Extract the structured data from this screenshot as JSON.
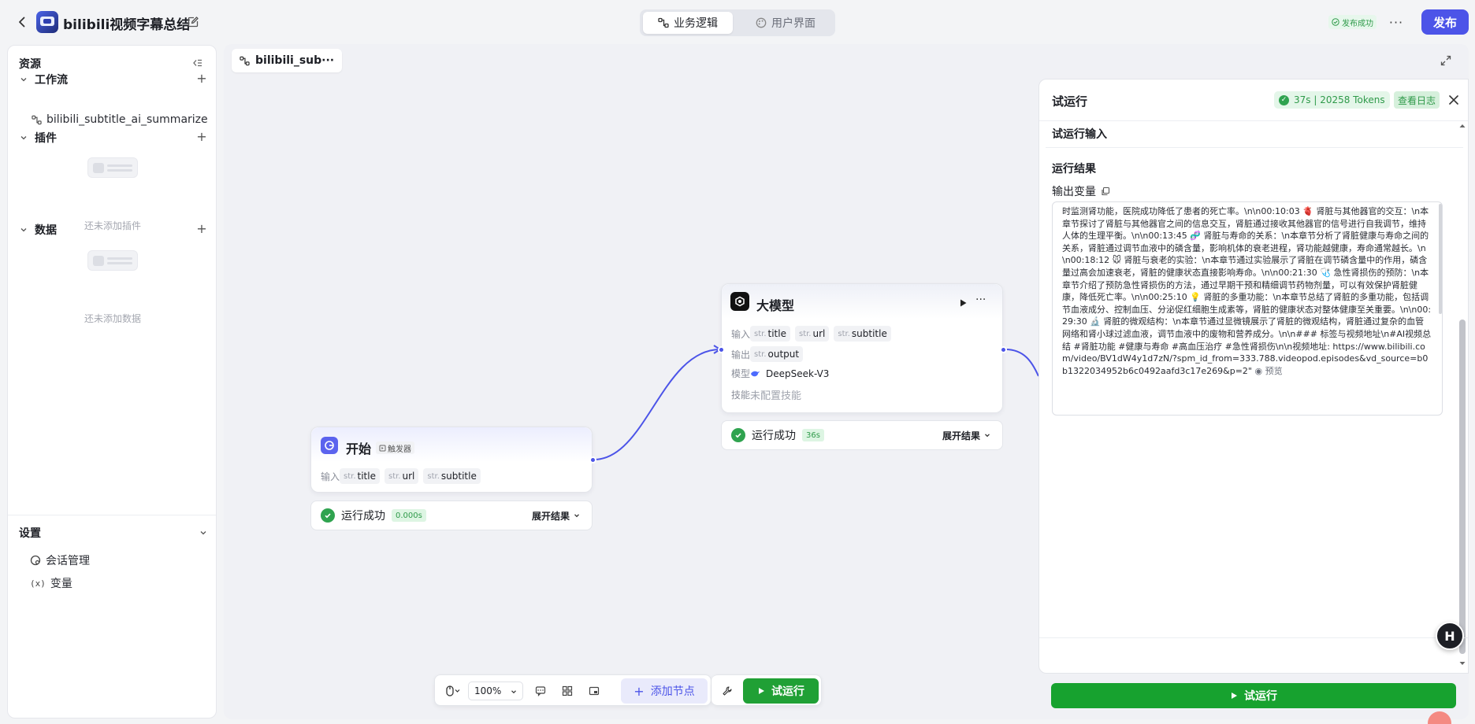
{
  "header": {
    "app_title": "bilibili视频字幕总结",
    "tabs": [
      {
        "label": "业务逻辑",
        "active": true
      },
      {
        "label": "用户界面",
        "active": false
      }
    ],
    "publish_status": "发布成功",
    "more": "···",
    "publish_label": "发布"
  },
  "sidebar": {
    "title": "资源",
    "sections": {
      "workflow": {
        "label": "工作流",
        "items": [
          "bilibili_subtitle_ai_summarize"
        ]
      },
      "plugin": {
        "label": "插件",
        "empty_text": "还未添加插件"
      },
      "data": {
        "label": "数据",
        "empty_text": "还未添加数据"
      }
    },
    "settings": {
      "label": "设置",
      "items": [
        "会话管理",
        "变量"
      ]
    }
  },
  "canvas": {
    "workflow_tab": "bilibili_sub···",
    "start_node": {
      "title": "开始",
      "badge": "触发器",
      "input_label": "输入",
      "inputs": [
        {
          "type": "str.",
          "name": "title"
        },
        {
          "type": "str.",
          "name": "url"
        },
        {
          "type": "str.",
          "name": "subtitle"
        }
      ],
      "result": {
        "status": "运行成功",
        "time": "0.000s",
        "expand": "展开结果"
      }
    },
    "llm_node": {
      "title": "大模型",
      "input_label": "输入",
      "inputs": [
        {
          "type": "str.",
          "name": "title"
        },
        {
          "type": "str.",
          "name": "url"
        },
        {
          "type": "str.",
          "name": "subtitle"
        }
      ],
      "output_label": "输出",
      "outputs": [
        {
          "type": "str.",
          "name": "output"
        }
      ],
      "model_label": "模型",
      "model": "DeepSeek-V3",
      "skill_label": "技能",
      "skill": "未配置技能",
      "result": {
        "status": "运行成功",
        "time": "36s",
        "expand": "展开结果"
      }
    },
    "toolbar": {
      "zoom": "100%",
      "add_node": "添加节点",
      "run": "试运行"
    }
  },
  "run_panel": {
    "title": "试运行",
    "stats": "37s | 20258 Tokens",
    "view_log": "查看日志",
    "input_section": "试运行输入",
    "result_section": "运行结果",
    "output_var_label": "输出变量",
    "output_text": "时监测肾功能，医院成功降低了患者的死亡率。\\n\\n00:10:03 🫀 肾脏与其他器官的交互：\\n本章节探讨了肾脏与其他器官之间的信息交互，肾脏通过接收其他器官的信号进行自我调节，维持人体的生理平衡。\\n\\n00:13:45 🧬 肾脏与寿命的关系：\\n本章节分析了肾脏健康与寿命之间的关系，肾脏通过调节血液中的磷含量，影响机体的衰老进程，肾功能越健康，寿命通常越长。\\n\\n00:18:12 🐭 肾脏与衰老的实验：\\n本章节通过实验展示了肾脏在调节磷含量中的作用，磷含量过高会加速衰老，肾脏的健康状态直接影响寿命。\\n\\n00:21:30 🩺 急性肾损伤的预防：\\n本章节介绍了预防急性肾损伤的方法，通过早期干预和精细调节药物剂量，可以有效保护肾脏健康，降低死亡率。\\n\\n00:25:10 💡 肾脏的多重功能：\\n本章节总结了肾脏的多重功能，包括调节血液成分、控制血压、分泌促红细胞生成素等，肾脏的健康状态对整体健康至关重要。\\n\\n00:29:30 🔬 肾脏的微观结构：\\n本章节通过显微镜展示了肾脏的微观结构，肾脏通过复杂的血管网络和肾小球过滤血液，调节血液中的废物和营养成分。\\n\\n### 标签与视频地址\\n#AI视频总结 #肾脏功能 #健康与寿命 #高血压治疗 #急性肾损伤\\n\\n视频地址: https://www.bilibili.com/video/BV1dW4y1d7zN/?spm_id_from=333.788.videopod.episodes&vd_source=b0b1322034952b6c0492aafd3c17e269&p=2\"",
    "preview": "预览",
    "run_label": "试运行"
  },
  "colors": {
    "accent": "#4c54e8",
    "success": "#20a035"
  }
}
